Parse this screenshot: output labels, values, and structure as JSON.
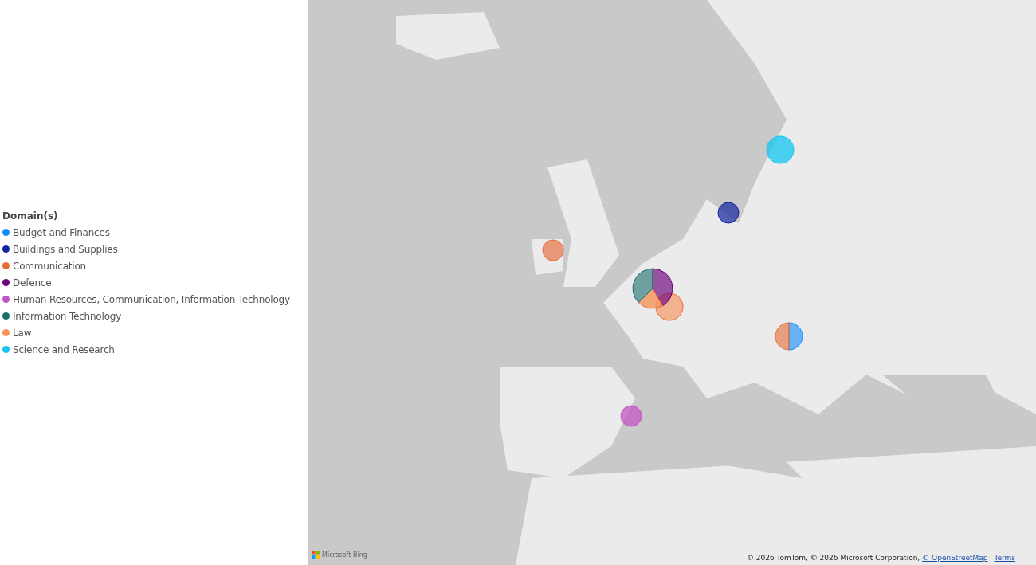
{
  "legend": {
    "title": "Domain(s)",
    "items": [
      {
        "label": "Budget and Finances",
        "color": "#118dff"
      },
      {
        "label": "Buildings and Supplies",
        "color": "#12239e"
      },
      {
        "label": "Communication",
        "color": "#e66c37"
      },
      {
        "label": "Defence",
        "color": "#6b007b"
      },
      {
        "label": "Human Resources, Communication, Information Technology",
        "color": "#c156c3"
      },
      {
        "label": "Information Technology",
        "color": "#1b6e6e"
      },
      {
        "label": "Law",
        "color": "#f5945a"
      },
      {
        "label": "Science and Research",
        "color": "#13c5f0"
      }
    ]
  },
  "map": {
    "logo": "Microsoft Bing",
    "attribution": {
      "text": "© 2026 TomTom, © 2026 Microsoft Corporation, ",
      "link": "© OpenStreetMap",
      "terms": "Terms"
    }
  }
}
